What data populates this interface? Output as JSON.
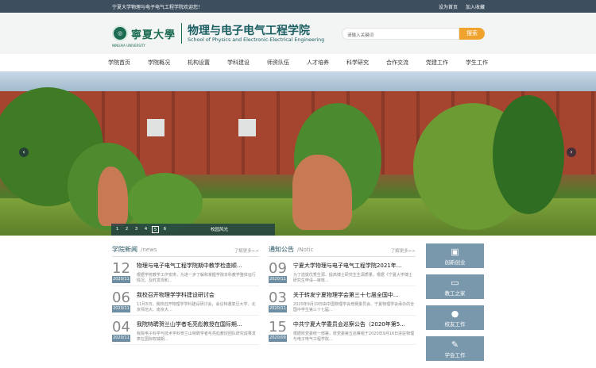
{
  "topbar": {
    "welcome": "宁夏大学物理与电子电气工程学院欢迎您！",
    "set_home": "设为首页",
    "bookmark": "加入收藏"
  },
  "header": {
    "logo_script": "寧夏大學",
    "logo_sub": "NINGXIA UNIVERSITY",
    "title_cn": "物理与电子电气工程学院",
    "title_en": "School of Physics and Electronic-Electrical Engineering",
    "search_placeholder": "请输入关键词",
    "search_button": "搜索"
  },
  "nav": [
    "学院首页",
    "学院概况",
    "机构设置",
    "学科建设",
    "师资队伍",
    "人才培养",
    "科学研究",
    "合作交流",
    "党建工作",
    "学生工作"
  ],
  "banner": {
    "pages": [
      "1",
      "2",
      "3",
      "4",
      "5",
      "6"
    ],
    "active": "5",
    "caption": "校园风光"
  },
  "news": {
    "title": "学院新闻",
    "subtitle": "/news",
    "more": "了解更多>>",
    "items": [
      {
        "day": "12",
        "month": "2020/11",
        "headline": "物理与电子电气工程学院期中教学检查顺...",
        "summary": "根据学校教学工作安排，为进一步了解和掌握学院本科教学整体运行情况，及时发现和..."
      },
      {
        "day": "06",
        "month": "2020/11",
        "headline": "我校召开物理学学科建设研讨会",
        "summary": "11月5日，我校召开物理学学科建设研讨会，会议特邀复旦大学、北京师范大、南京大..."
      },
      {
        "day": "04",
        "month": "2020/11",
        "headline": "我院特聘贺兰山学者毛亮彪教授在国际期...",
        "summary": "我院电子科学与技术学科贺兰山特聘学者毛亮彪教授团队研究成果发表在国际权威期..."
      }
    ]
  },
  "notice": {
    "title": "通知公告",
    "subtitle": "/Notic",
    "more": "了解更多>>",
    "items": [
      {
        "day": "09",
        "month": "2020/11",
        "headline": "宁夏大学物理与电子电气工程学院2021年...",
        "summary": "为了选拔优秀生源，提高博士研究生生源质量，根据《宁夏大学博士研究生申请—审核..."
      },
      {
        "day": "03",
        "month": "2020/11",
        "headline": "关于转发宁夏物理学会第三十七届全国中...",
        "summary": "2020年9月19日由中国物理学会竞赛委员会、宁夏物理学会承办的全国中学生第三十七届..."
      },
      {
        "day": "15",
        "month": "2020/09",
        "headline": "中共宁夏大学委员会巡察公告（2020年第5...",
        "summary": "根据校党委统一部署，校党委第五巡察组于2020年9月16日进驻物理与电子电气工程学院..."
      }
    ]
  },
  "side": [
    "创新创业",
    "教工之家",
    "校友工作",
    "学会工作"
  ],
  "colors": {
    "topbar": "#3d4f5e",
    "accent": "#f0a32c",
    "brand": "#1b5f62",
    "tile": "#7a98ac"
  }
}
